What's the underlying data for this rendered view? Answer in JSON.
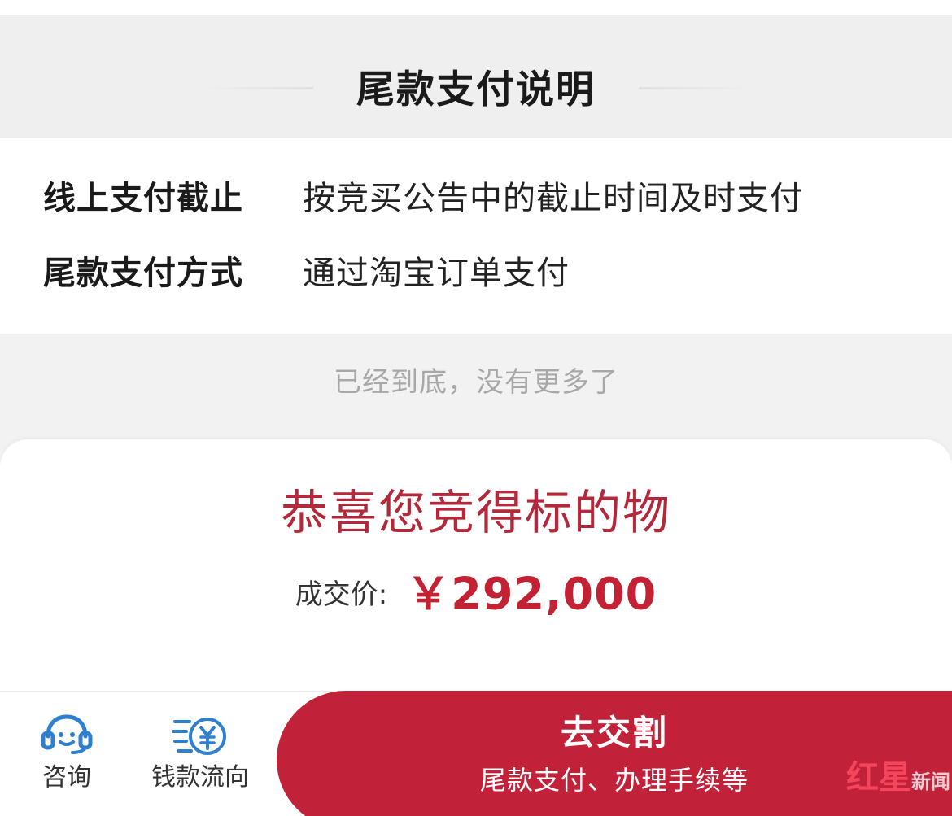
{
  "section": {
    "title": "尾款支付说明"
  },
  "info": {
    "rows": [
      {
        "label": "线上支付截止",
        "value": "按竞买公告中的截止时间及时支付"
      },
      {
        "label": "尾款支付方式",
        "value": "通过淘宝订单支付"
      }
    ]
  },
  "list_end": "已经到底，没有更多了",
  "modal": {
    "congrats": "恭喜您竞得标的物",
    "price_label": "成交价:",
    "price_value": "￥292,000"
  },
  "bottom_bar": {
    "consult_label": "咨询",
    "consult_icon": "customer-service-icon",
    "flow_label": "钱款流向",
    "flow_icon": "yuan-flow-icon",
    "pay_title": "去交割",
    "pay_subtitle": "尾款支付、办理手续等"
  },
  "watermark": {
    "main": "红星",
    "suffix": "新闻"
  },
  "colors": {
    "accent": "#c2213a",
    "congrats_text": "#b3283a",
    "icon_blue": "#2f7fd0"
  }
}
